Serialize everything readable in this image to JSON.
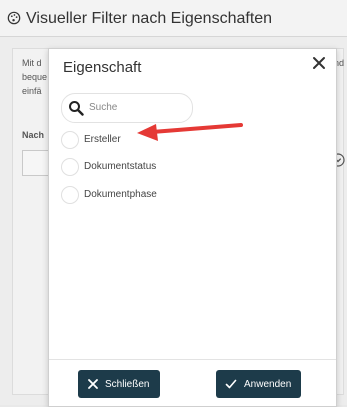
{
  "page": {
    "title": "Visueller Filter nach Eigenschaften",
    "fragments": [
      "Mit d",
      "beque",
      "einfä",
      "Nach",
      "nd"
    ]
  },
  "dialog": {
    "title": "Eigenschaft",
    "search_placeholder": "Suche",
    "options": [
      "Ersteller",
      "Dokumentstatus",
      "Dokumentphase"
    ],
    "close_label": "Schließen",
    "apply_label": "Anwenden"
  },
  "annotation": {
    "color": "#e53935",
    "target": "Ersteller"
  },
  "colors": {
    "button_bg": "#1d3b4a"
  }
}
